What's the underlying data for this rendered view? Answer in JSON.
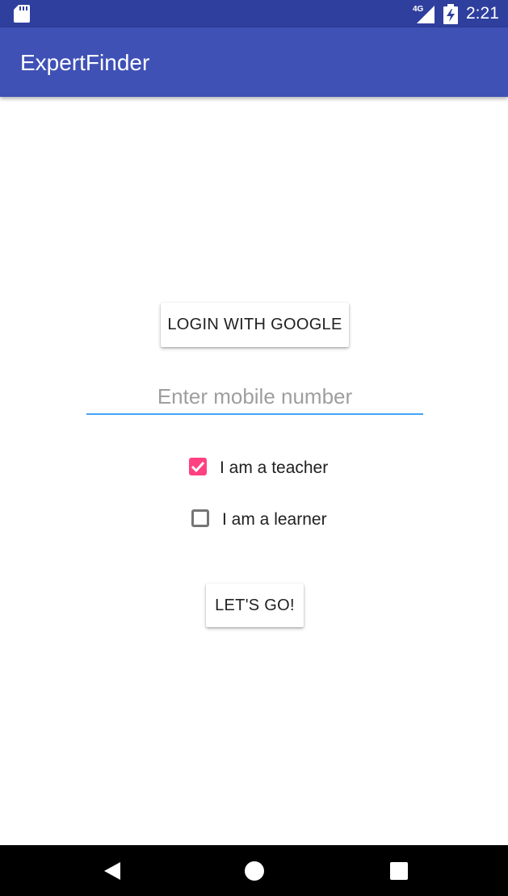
{
  "status_bar": {
    "time": "2:21",
    "network_label": "4G",
    "icons": [
      "sd-card-icon",
      "signal-icon",
      "battery-icon"
    ]
  },
  "app_bar": {
    "title": "ExpertFinder"
  },
  "main": {
    "google_button_label": "LOGIN WITH GOOGLE",
    "mobile_input": {
      "placeholder": "Enter mobile number",
      "value": ""
    },
    "checkboxes": [
      {
        "label": "I am a teacher",
        "checked": true
      },
      {
        "label": "I am a learner",
        "checked": false
      }
    ],
    "go_button_label": "LET'S GO!"
  },
  "nav_bar": {
    "icons": [
      "back-icon",
      "home-icon",
      "recents-icon"
    ]
  },
  "colors": {
    "status_bar": "#2f3f9e",
    "app_bar": "#3f51b5",
    "accent": "#ff4081",
    "input_underline": "#42a5f5",
    "nav_bar": "#000000"
  }
}
